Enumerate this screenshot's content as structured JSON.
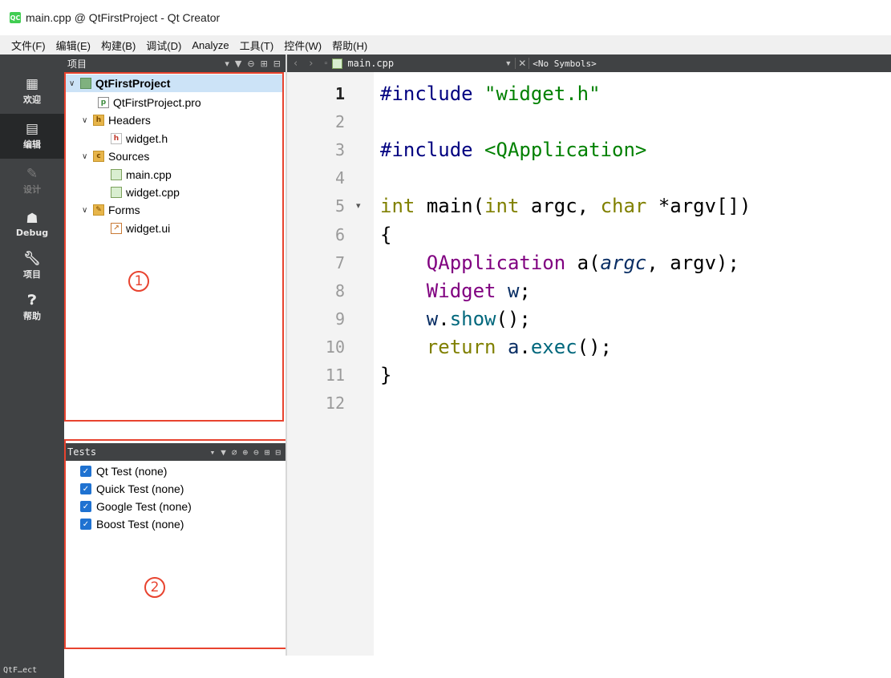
{
  "window": {
    "logo_text": "QC",
    "title": "main.cpp @ QtFirstProject - Qt Creator"
  },
  "menu": [
    "文件(F)",
    "编辑(E)",
    "构建(B)",
    "调试(D)",
    "Analyze",
    "工具(T)",
    "控件(W)",
    "帮助(H)"
  ],
  "modes": [
    {
      "label": "欢迎",
      "icon": "grid-icon"
    },
    {
      "label": "编辑",
      "icon": "edit-doc-icon"
    },
    {
      "label": "设计",
      "icon": "pencil-icon"
    },
    {
      "label": "Debug",
      "icon": "bug-icon"
    },
    {
      "label": "项目",
      "icon": "wrench-icon"
    },
    {
      "label": "帮助",
      "icon": "help-icon"
    }
  ],
  "mode_bottom_label": "QtF…ect",
  "project_panel": {
    "title": "项目",
    "tree": [
      {
        "label": "QtFirstProject",
        "icon": "project-icon",
        "bold": true,
        "expanded": true,
        "selected": true
      },
      {
        "label": "QtFirstProject.pro",
        "icon": "pro-file-icon"
      },
      {
        "label": "Headers",
        "icon": "headers-folder-icon",
        "expanded": true
      },
      {
        "label": "widget.h",
        "icon": "header-file-icon"
      },
      {
        "label": "Sources",
        "icon": "sources-folder-icon",
        "expanded": true
      },
      {
        "label": "main.cpp",
        "icon": "cpp-file-icon"
      },
      {
        "label": "widget.cpp",
        "icon": "cpp-file-icon"
      },
      {
        "label": "Forms",
        "icon": "forms-folder-icon",
        "expanded": true
      },
      {
        "label": "widget.ui",
        "icon": "ui-file-icon"
      }
    ]
  },
  "tests_panel": {
    "title": "Tests",
    "items": [
      {
        "label": "Qt Test (none)",
        "checked": true
      },
      {
        "label": "Quick Test (none)",
        "checked": true
      },
      {
        "label": "Google Test (none)",
        "checked": true
      },
      {
        "label": "Boost Test (none)",
        "checked": true
      }
    ]
  },
  "annotations": [
    "1",
    "2"
  ],
  "editor_toolbar": {
    "filename": "main.cpp",
    "symbols": "<No Symbols>"
  },
  "editor": {
    "current_line": 1,
    "line_numbers": [
      "1",
      "2",
      "3",
      "4",
      "5",
      "6",
      "7",
      "8",
      "9",
      "10",
      "11",
      "12"
    ],
    "fold_marker_line": 5,
    "code": [
      "#include \"widget.h\"",
      "",
      "#include <QApplication>",
      "",
      "int main(int argc, char *argv[])",
      "{",
      "    QApplication a(argc, argv);",
      "    Widget w;",
      "    w.show();",
      "    return a.exec();",
      "}",
      ""
    ]
  },
  "colors": {
    "sidebar_bg": "#404244",
    "active_mode_bg": "#262829",
    "selection_bg": "#cce3f7",
    "annotation_red": "#e8432f",
    "checkbox_blue": "#1f72d1"
  }
}
